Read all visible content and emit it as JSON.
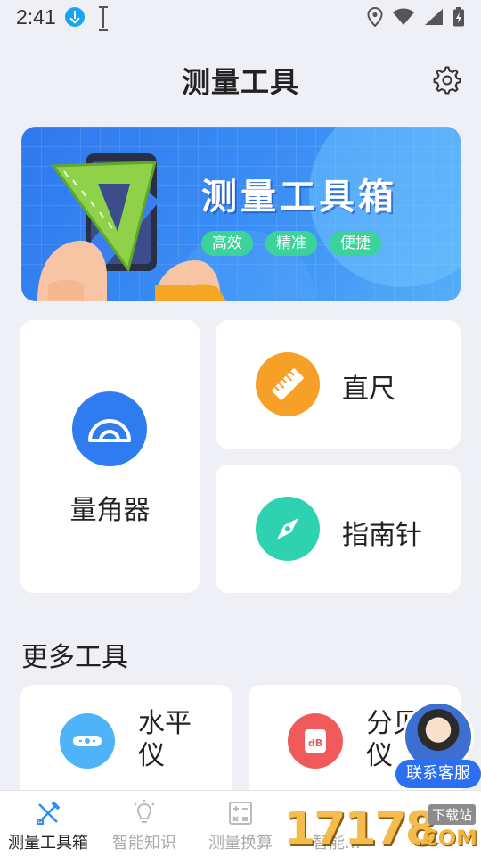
{
  "status_bar": {
    "time": "2:41"
  },
  "header": {
    "title": "测量工具"
  },
  "banner": {
    "title": "测量工具箱",
    "tags": [
      "高效",
      "精准",
      "便捷"
    ]
  },
  "tools": {
    "protractor": {
      "label": "量角器",
      "color": "#2f7cf0"
    },
    "ruler": {
      "label": "直尺",
      "color": "#f7a028"
    },
    "compass": {
      "label": "指南针",
      "color": "#2fd2b0"
    }
  },
  "more_tools": {
    "title": "更多工具",
    "items": [
      {
        "label": "水平\n仪",
        "color": "#4fb4f7"
      },
      {
        "label": "分贝\n仪",
        "color": "#f05a5a"
      }
    ]
  },
  "support": {
    "label": "联系客服"
  },
  "bottom_nav": {
    "items": [
      {
        "label": "测量工具箱",
        "active": true
      },
      {
        "label": "智能知识",
        "active": false
      },
      {
        "label": "测量换算",
        "active": false
      },
      {
        "label": "智能…",
        "active": false
      },
      {
        "label": "…",
        "active": false
      }
    ]
  },
  "watermark": {
    "text": "17178",
    "sub": "下载站",
    "suffix": ".COM"
  }
}
